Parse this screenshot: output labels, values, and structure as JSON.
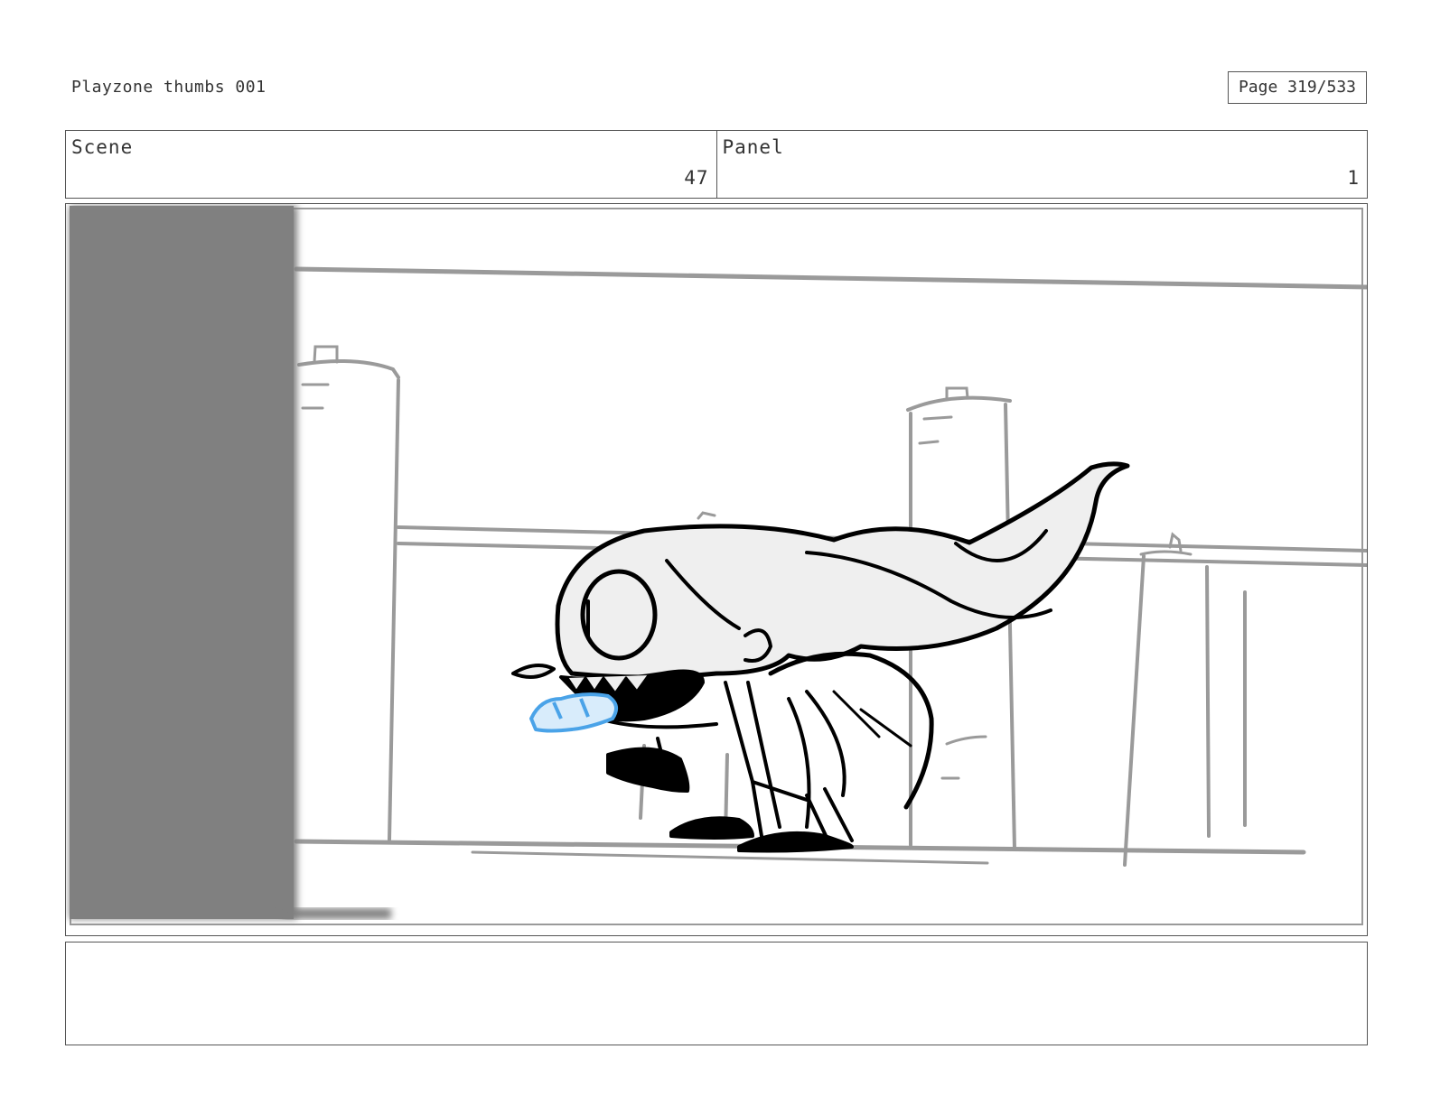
{
  "header": {
    "document_title": "Playzone thumbs 001",
    "page_counter": "Page 319/533"
  },
  "info": {
    "scene_label": "Scene",
    "scene_number": "47",
    "panel_label": "Panel",
    "panel_number": "1"
  },
  "drawing": {
    "description_colors": {
      "wall_shadow": "#808080",
      "sketch_lines": "#9a9a9a",
      "ink": "#000000",
      "creature_fill": "#efefef",
      "crystal": "#4aa3e8"
    }
  },
  "notes": {
    "text": ""
  }
}
